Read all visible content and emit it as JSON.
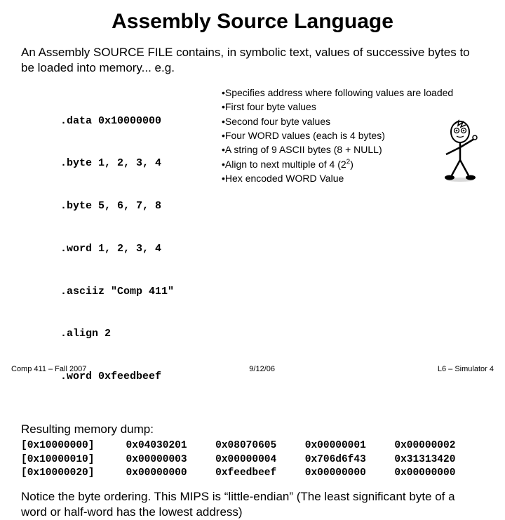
{
  "title": "Assembly Source Language",
  "intro": "An Assembly SOURCE FILE contains, in symbolic text, values of successive bytes to be loaded into memory... e.g.",
  "code": [
    ".data 0x10000000",
    ".byte 1, 2, 3, 4",
    ".byte 5, 6, 7, 8",
    ".word 1, 2, 3, 4",
    ".asciiz \"Comp 411\"",
    ".align 2",
    ".word 0xfeedbeef"
  ],
  "notes": [
    "•Specifies address where following values are loaded",
    "•First four byte values",
    "•Second four byte values",
    "•Four WORD values  (each is 4 bytes)",
    "•A string of 9 ASCII bytes (8 + NULL)",
    "•Align to next multiple of 4 (2",
    "•Hex encoded WORD Value"
  ],
  "note5_sup": "2",
  "note5_tail": ")",
  "result_heading": "Resulting memory dump:",
  "dump": [
    {
      "addr": "[0x10000000]",
      "cells": [
        "0x04030201",
        "0x08070605",
        "0x00000001",
        "0x00000002"
      ]
    },
    {
      "addr": "[0x10000010]",
      "cells": [
        "0x00000003",
        "0x00000004",
        "0x706d6f43",
        "0x31313420"
      ]
    },
    {
      "addr": "[0x10000020]",
      "cells": [
        "0x00000000",
        "0xfeedbeef",
        "0x00000000",
        "0x00000000"
      ]
    }
  ],
  "closing": "Notice the byte ordering. This MIPS is “little-endian”  (The least significant byte of a word or half-word has the lowest address)",
  "footer": {
    "left": "Comp 411 – Fall 2007",
    "center": "9/12/06",
    "right": "L6 – Simulator   4"
  }
}
